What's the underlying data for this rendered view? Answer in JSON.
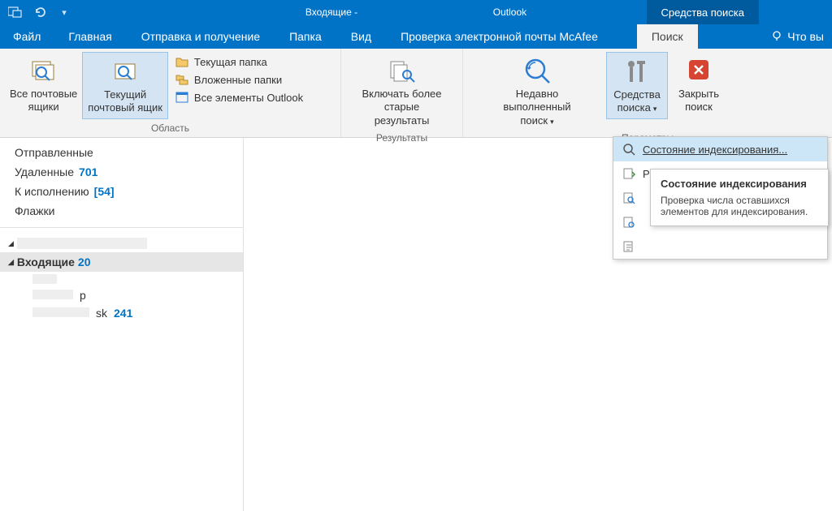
{
  "title": {
    "prefix": "Входящие - ",
    "suffix": " Outlook"
  },
  "context_tab": "Средства поиска",
  "tabs": {
    "file": "Файл",
    "home": "Главная",
    "sendrecv": "Отправка и получение",
    "folder": "Папка",
    "view": "Вид",
    "mcafee": "Проверка электронной почты McAfee",
    "search": "Поиск",
    "tellme": "Что вы"
  },
  "ribbon": {
    "scope": {
      "label": "Область",
      "all_mailboxes": "Все почтовые\nящики",
      "current_mailbox": "Текущий\nпочтовый ящик",
      "current_folder": "Текущая папка",
      "subfolders": "Вложенные папки",
      "all_outlook": "Все элементы Outlook"
    },
    "results": {
      "label": "Результаты",
      "include_older": "Включать более\nстарые результаты"
    },
    "options": {
      "label": "Параметры",
      "recent": "Недавно выполненный\nпоиск",
      "tools": "Средства\nпоиска",
      "close": "Закрыть\nпоиск"
    }
  },
  "nav": {
    "sent": "Отправленные",
    "deleted": {
      "label": "Удаленные",
      "count": "701"
    },
    "followup": {
      "label": "К исполнению",
      "count": "54"
    },
    "flags": "Флажки",
    "inbox": {
      "label": "Входящие",
      "count": "20"
    },
    "sub_sk": {
      "suffix": "sk",
      "count": "241"
    },
    "sub_p": {
      "suffix": "р"
    }
  },
  "menu": {
    "indexing_status": "Состояние индексирования...",
    "item2": "Р",
    "item3": "",
    "item4": "",
    "item5": ""
  },
  "tooltip": {
    "title": "Состояние индексирования",
    "body": "Проверка числа оставшихся элементов для индексирования."
  }
}
